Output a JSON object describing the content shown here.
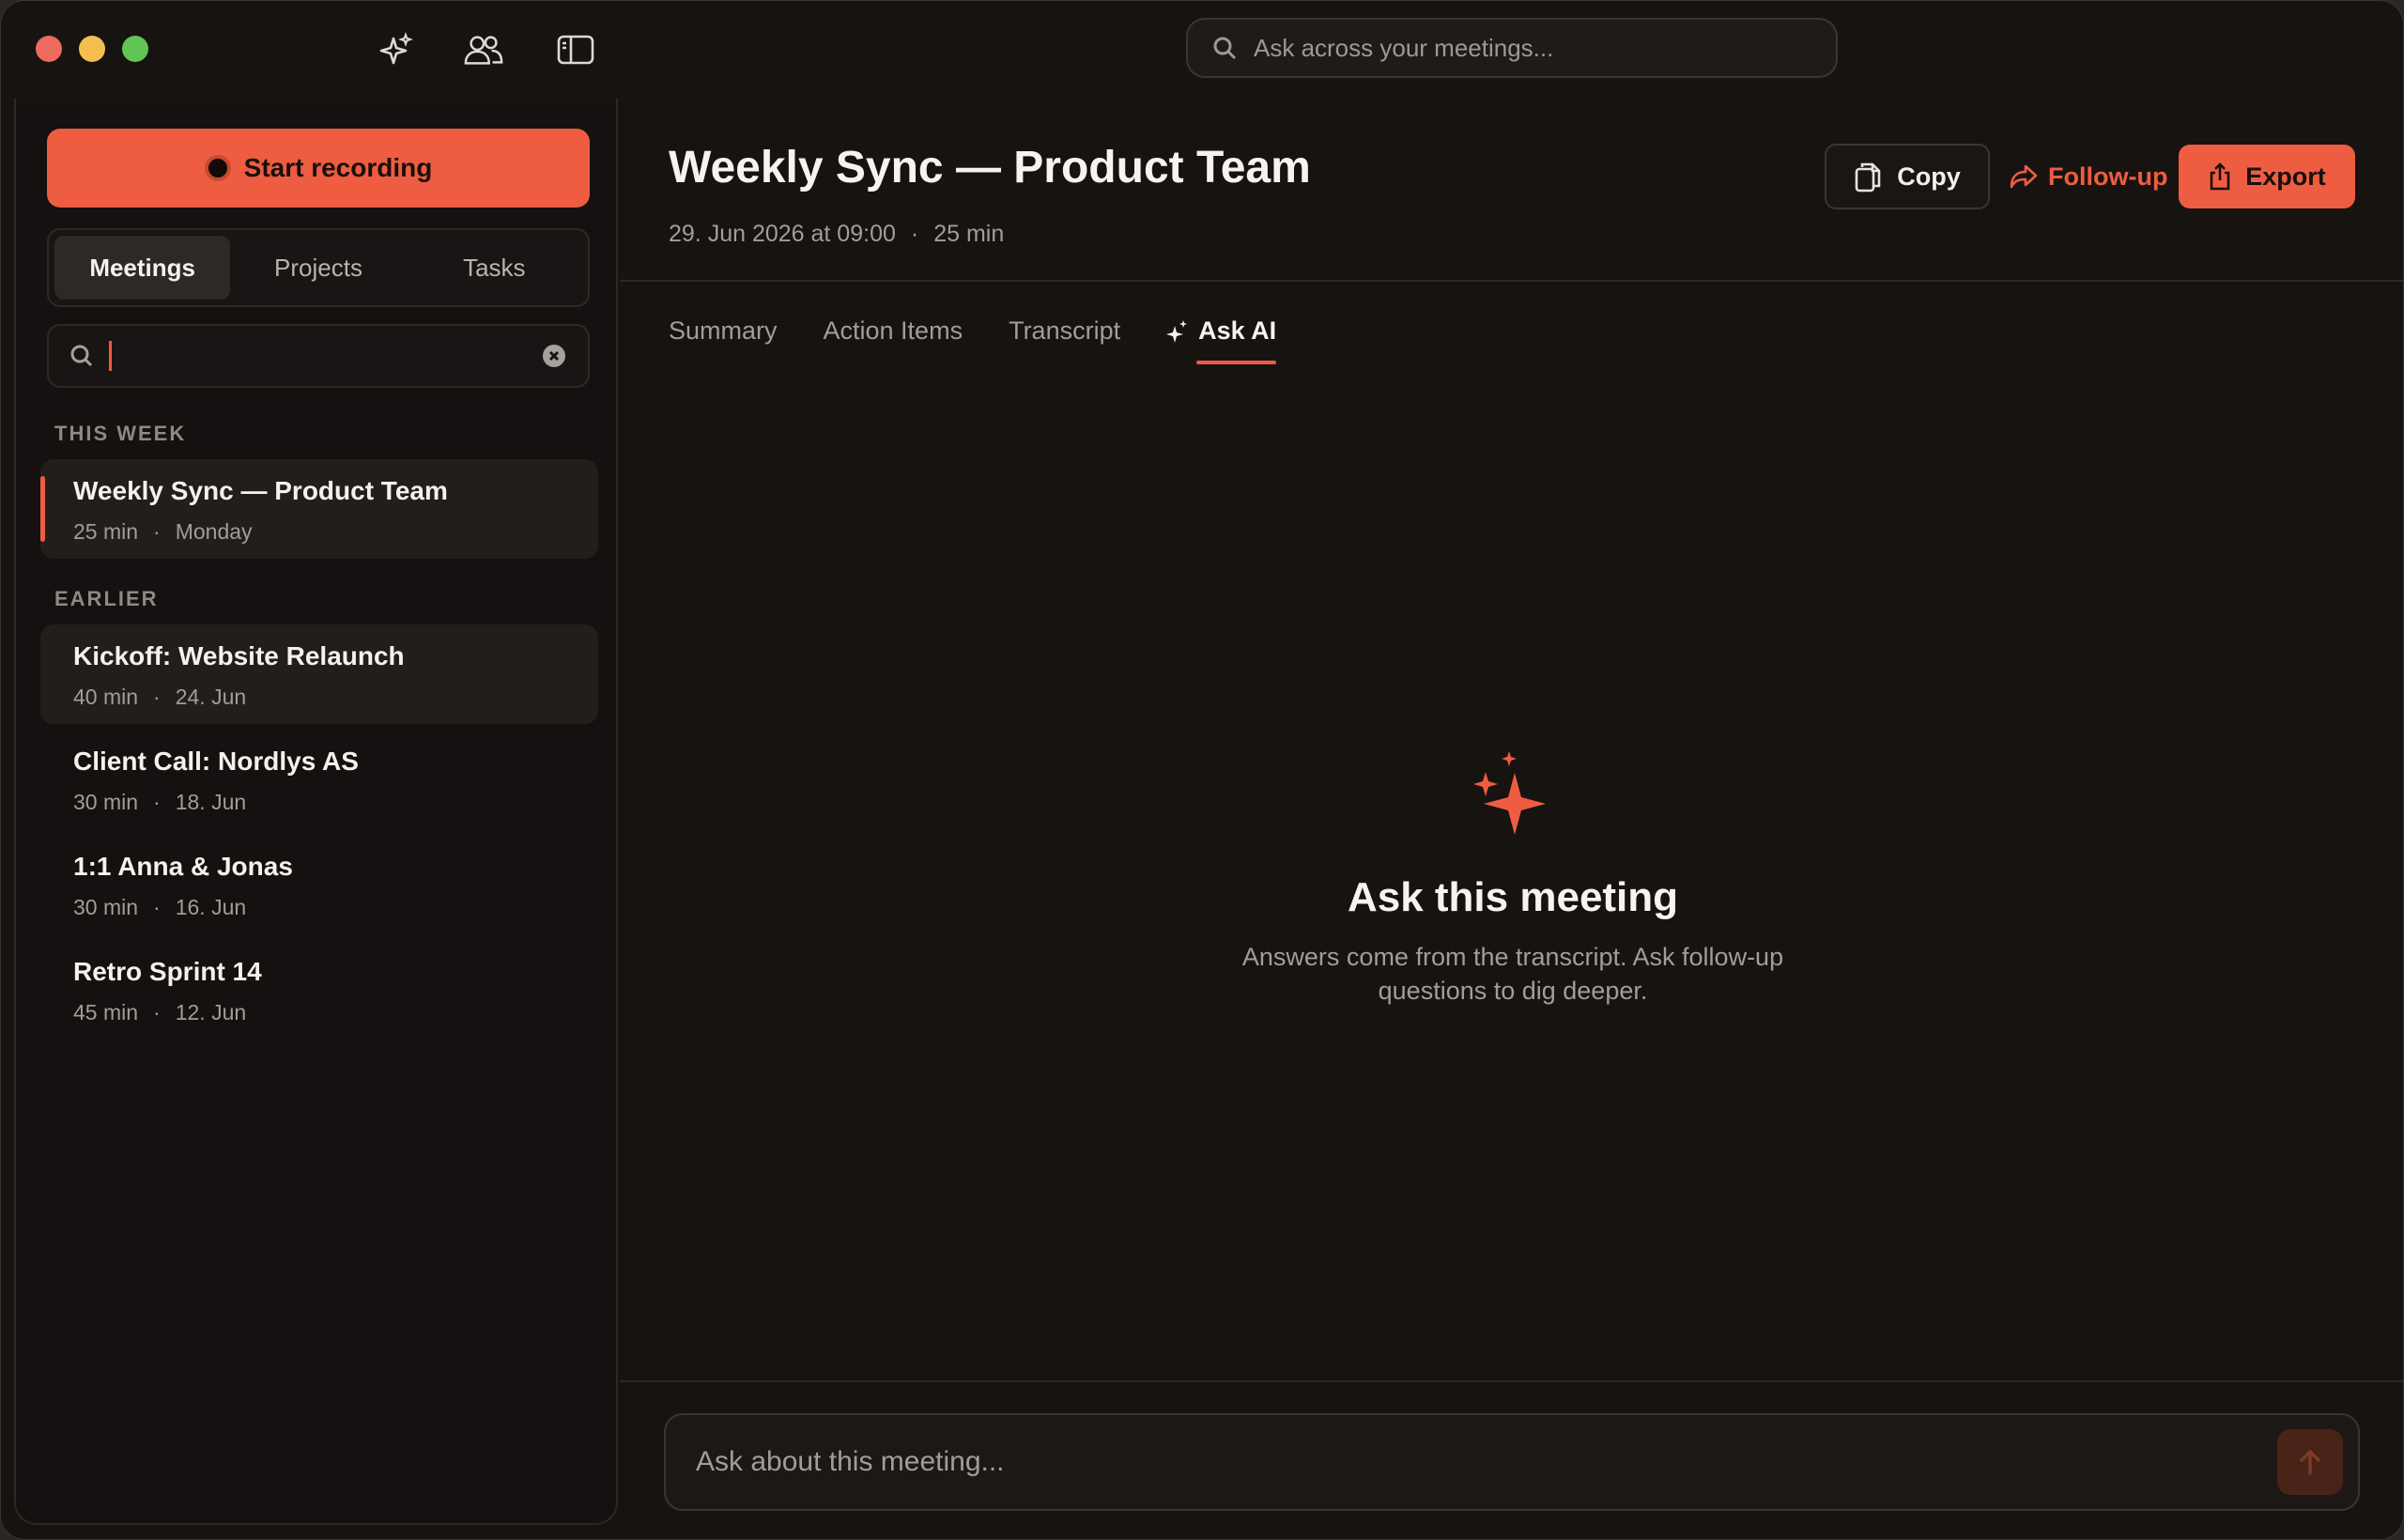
{
  "titlebar": {
    "icons": [
      "sparkle-icon",
      "people-icon",
      "sidebar-toggle-icon"
    ],
    "search_placeholder": "Ask across your meetings..."
  },
  "sidebar": {
    "record_label": "Start recording",
    "segments": [
      "Meetings",
      "Projects",
      "Tasks"
    ],
    "active_segment": "Meetings",
    "search_value": "",
    "groups": [
      {
        "label": "THIS WEEK",
        "meetings": [
          {
            "title": "Weekly Sync — Product Team",
            "duration": "25 min",
            "date": "Monday",
            "selected": true
          }
        ]
      },
      {
        "label": "EARLIER",
        "meetings": [
          {
            "title": "Kickoff: Website Relaunch",
            "duration": "40 min",
            "date": "24. Jun"
          },
          {
            "title": "Client Call: Nordlys AS",
            "duration": "30 min",
            "date": "18. Jun"
          },
          {
            "title": "1:1 Anna & Jonas",
            "duration": "30 min",
            "date": "16. Jun"
          },
          {
            "title": "Retro Sprint 14",
            "duration": "45 min",
            "date": "12. Jun"
          }
        ]
      }
    ]
  },
  "main": {
    "title": "Weekly Sync — Product Team",
    "datetime": "29. Jun 2026 at 09:00",
    "duration": "25 min",
    "actions": {
      "copy": "Copy",
      "follow_up": "Follow-up",
      "export": "Export"
    },
    "tabs": [
      "Summary",
      "Action Items",
      "Transcript",
      "Ask AI"
    ],
    "active_tab": "Ask AI",
    "empty_state": {
      "title": "Ask this meeting",
      "description": "Answers come from the transcript. Ask follow-up questions to dig deeper."
    },
    "composer_placeholder": "Ask about this meeting..."
  },
  "colors": {
    "accent": "#ee5d41",
    "background": "#171311",
    "text": "#f3efe9",
    "muted": "#a39d97"
  }
}
